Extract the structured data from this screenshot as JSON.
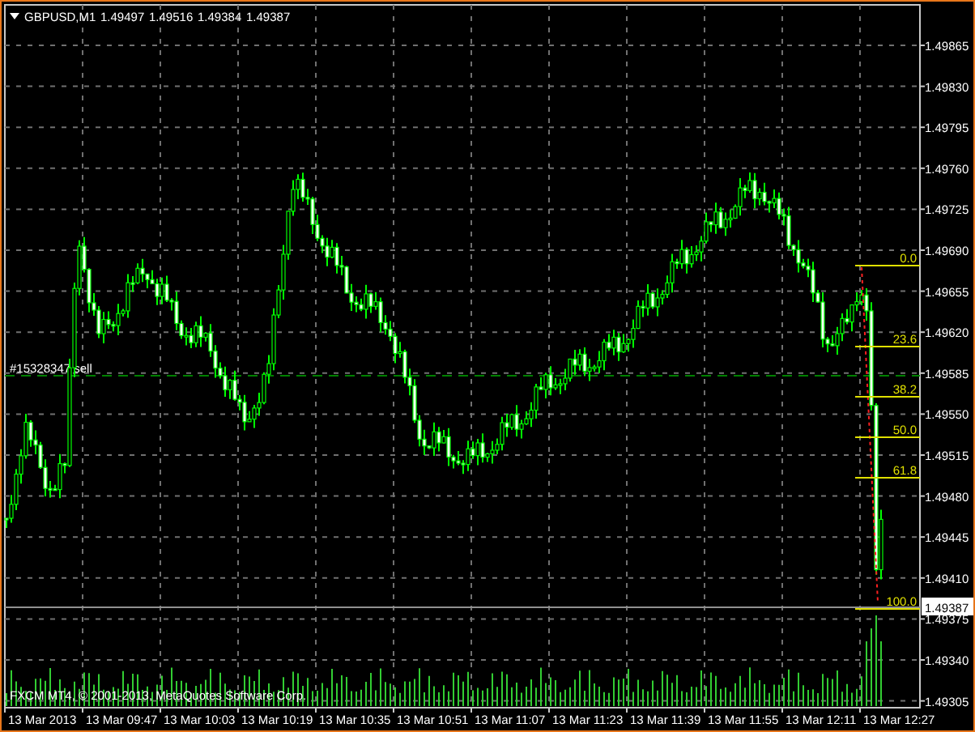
{
  "chart_header": {
    "symbol": "GBPUSD,M1",
    "prices": [
      "1.49497",
      "1.49516",
      "1.49384",
      "1.49387"
    ]
  },
  "price_axis": [
    "1.49865",
    "1.49830",
    "1.49795",
    "1.49760",
    "1.49725",
    "1.49690",
    "1.49655",
    "1.49620",
    "1.49585",
    "1.49550",
    "1.49515",
    "1.49480",
    "1.49445",
    "1.49410",
    "1.49375",
    "1.49340",
    "1.49305"
  ],
  "current_price": "1.49387",
  "time_axis": [
    "13 Mar 2013",
    "13 Mar 09:47",
    "13 Mar 10:03",
    "13 Mar 10:19",
    "13 Mar 10:35",
    "13 Mar 10:51",
    "13 Mar 11:07",
    "13 Mar 11:23",
    "13 Mar 11:39",
    "13 Mar 11:55",
    "13 Mar 12:11",
    "13 Mar 12:27"
  ],
  "fibonacci_levels": [
    "0.0",
    "23.6",
    "38.2",
    "50.0",
    "61.8",
    "100.0"
  ],
  "order_label": "#15328347 sell",
  "copyright": "FXCM MT4, © 2001-2013, MetaQuotes Software Corp."
}
